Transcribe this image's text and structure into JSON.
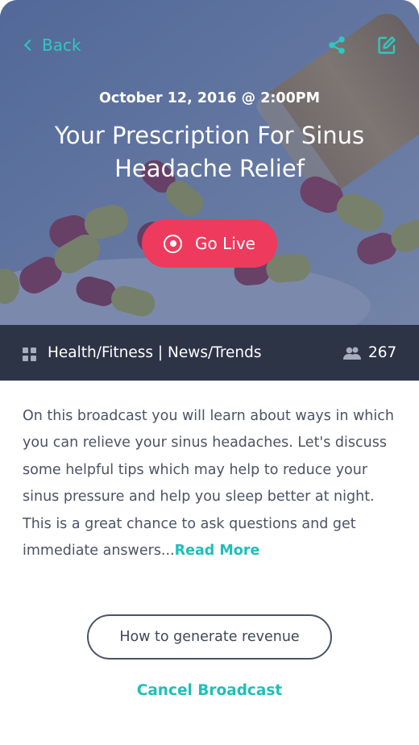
{
  "header": {
    "back_label": "Back",
    "back_icon": "chevron-left-icon",
    "share_icon": "share-icon",
    "edit_icon": "edit-icon"
  },
  "event": {
    "datetime": "October 12, 2016 @ 2:00PM",
    "title": "Your Prescription For Sinus Headache Relief",
    "go_live_label": "Go Live",
    "go_live_icon": "record-icon",
    "hero_image": "pills-spilling-from-bottle-photo"
  },
  "category_bar": {
    "icon": "grid-icon",
    "categories_text": "Health/Fitness | News/Trends",
    "viewers_icon": "people-icon",
    "viewers_count": "267"
  },
  "description": {
    "text": "On this broadcast you will learn about ways in which you can relieve your sinus headaches. Let's discuss some helpful tips which may help to reduce your sinus pressure and help you sleep better at night. This is a great chance to ask questions and get immediate answers...",
    "read_more_label": "Read More"
  },
  "actions": {
    "revenue_button_label": "How to generate revenue",
    "cancel_label": "Cancel Broadcast"
  },
  "colors": {
    "accent_teal": "#1fbfb8",
    "live_red": "#ee3a5c",
    "hero_overlay": "#385087",
    "category_bar": "#2c3446",
    "body_text": "#4b5364"
  }
}
